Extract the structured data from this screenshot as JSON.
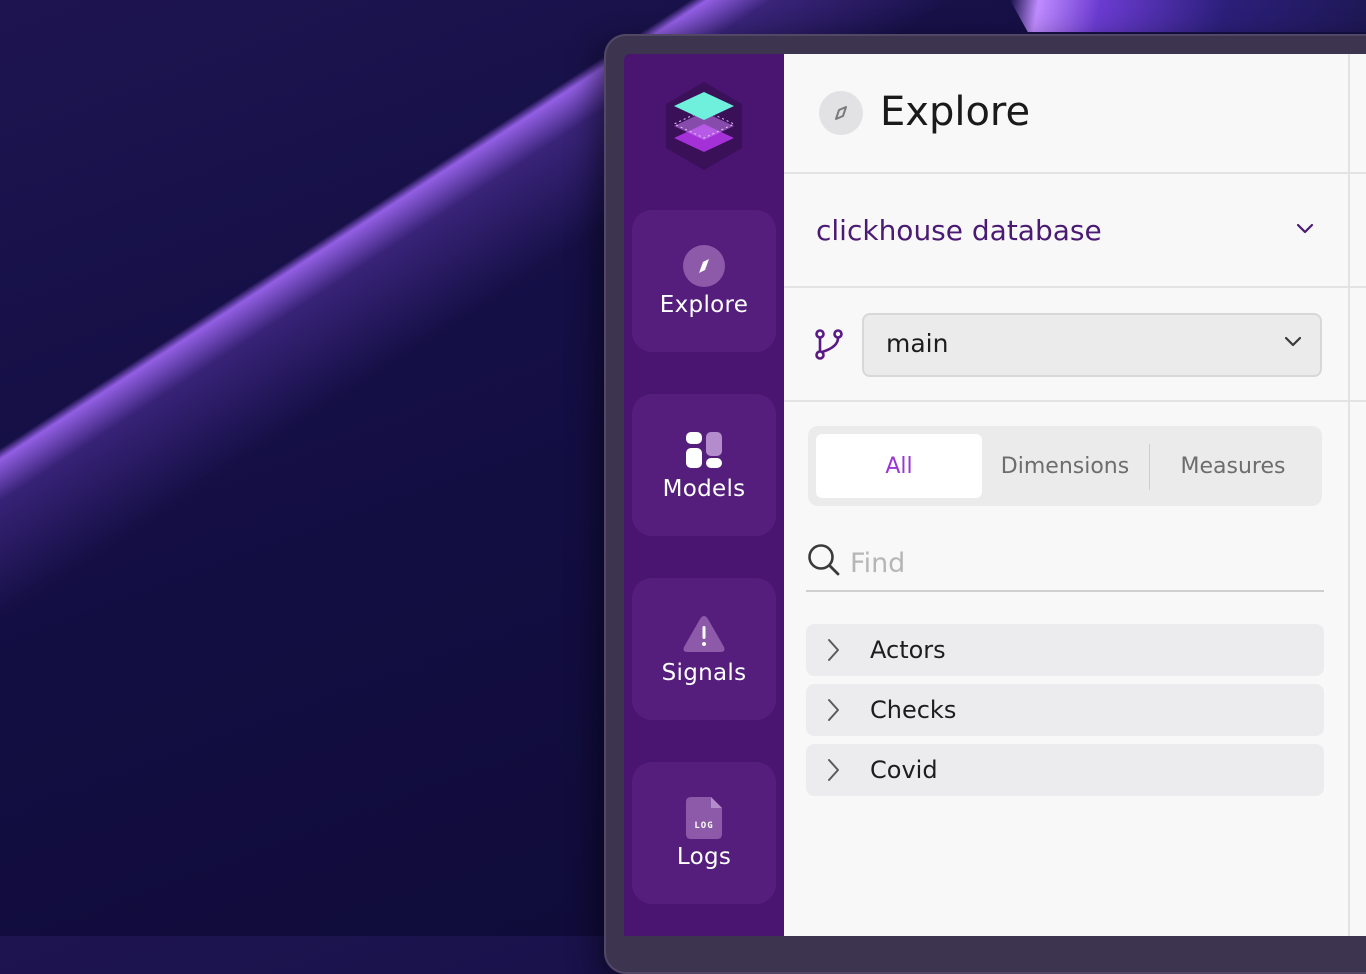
{
  "sidebar": {
    "items": [
      {
        "label": "Explore",
        "icon": "compass-icon"
      },
      {
        "label": "Models",
        "icon": "models-icon"
      },
      {
        "label": "Signals",
        "icon": "warning-triangle-icon"
      },
      {
        "label": "Logs",
        "icon": "log-file-icon"
      }
    ],
    "log_icon_text": "LOG"
  },
  "header": {
    "title": "Explore",
    "icon": "compass-icon"
  },
  "database": {
    "name": "clickhouse database"
  },
  "branch": {
    "value": "main",
    "icon": "git-branch-icon"
  },
  "tabs": [
    {
      "label": "All",
      "active": true
    },
    {
      "label": "Dimensions",
      "active": false
    },
    {
      "label": "Measures",
      "active": false
    }
  ],
  "search": {
    "placeholder": "Find",
    "value": ""
  },
  "list": [
    {
      "label": "Actors"
    },
    {
      "label": "Checks"
    },
    {
      "label": "Covid"
    }
  ],
  "colors": {
    "sidebar": "#4a1570",
    "accent": "#9b35d6",
    "database_text": "#4b1a73"
  }
}
